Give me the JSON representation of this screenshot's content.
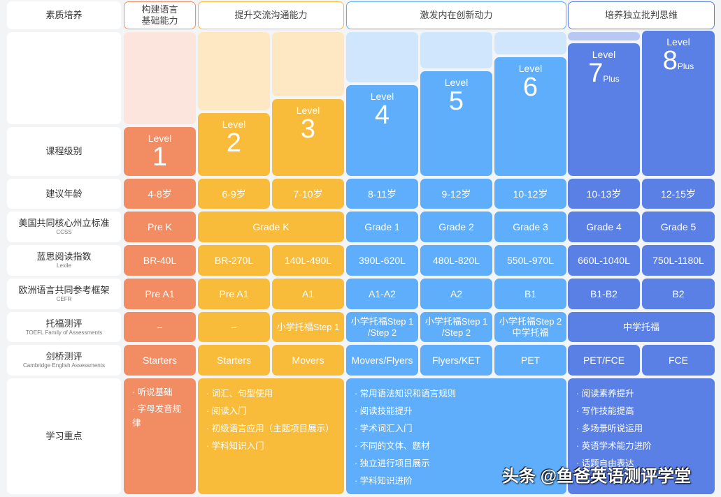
{
  "colors": {
    "orange": "#f28c63",
    "orange_light": "#fbe5dc",
    "yellow": "#f8bb3a",
    "yellow_light": "#fde8c3",
    "blue": "#5eaefc",
    "blue_light": "#cfe6fd",
    "indigo": "#5a80e6",
    "indigo_light": "#b9c8f3"
  },
  "header": {
    "label": "素质培养",
    "groups": [
      {
        "text": "构建语言基础能力",
        "span": [
          1,
          1
        ],
        "color": "orange"
      },
      {
        "text": "提升交流沟通能力",
        "span": [
          2,
          3
        ],
        "color": "yellow"
      },
      {
        "text": "激发内在创新动力",
        "span": [
          4,
          6
        ],
        "color": "blue"
      },
      {
        "text": "培养独立批判思维",
        "span": [
          7,
          8
        ],
        "color": "indigo"
      }
    ]
  },
  "level_label": "课程级别",
  "levels": [
    {
      "word": "Level",
      "num": "1",
      "suffix": ""
    },
    {
      "word": "Level",
      "num": "2",
      "suffix": ""
    },
    {
      "word": "Level",
      "num": "3",
      "suffix": ""
    },
    {
      "word": "Level",
      "num": "4",
      "suffix": ""
    },
    {
      "word": "Level",
      "num": "5",
      "suffix": ""
    },
    {
      "word": "Level",
      "num": "6",
      "suffix": ""
    },
    {
      "word": "Level",
      "num": "7",
      "suffix": "Plus"
    },
    {
      "word": "Level",
      "num": "8",
      "suffix": "Plus"
    }
  ],
  "rows": [
    {
      "label": "建议年龄",
      "sub": "",
      "cells": [
        {
          "t": "4-8岁",
          "s": [
            1,
            1
          ]
        },
        {
          "t": "6-9岁",
          "s": [
            2,
            2
          ]
        },
        {
          "t": "7-10岁",
          "s": [
            3,
            3
          ]
        },
        {
          "t": "8-11岁",
          "s": [
            4,
            4
          ]
        },
        {
          "t": "9-12岁",
          "s": [
            5,
            5
          ]
        },
        {
          "t": "10-12岁",
          "s": [
            6,
            6
          ]
        },
        {
          "t": "10-13岁",
          "s": [
            7,
            7
          ]
        },
        {
          "t": "12-15岁",
          "s": [
            8,
            8
          ]
        }
      ]
    },
    {
      "label": "美国共同核心州立标准",
      "sub": "CCSS",
      "cells": [
        {
          "t": "Pre K",
          "s": [
            1,
            1
          ]
        },
        {
          "t": "Grade K",
          "s": [
            2,
            3
          ]
        },
        {
          "t": "Grade 1",
          "s": [
            4,
            4
          ]
        },
        {
          "t": "Grade 2",
          "s": [
            5,
            5
          ]
        },
        {
          "t": "Grade 3",
          "s": [
            6,
            6
          ]
        },
        {
          "t": "Grade 4",
          "s": [
            7,
            7
          ]
        },
        {
          "t": "Grade 5",
          "s": [
            8,
            8
          ]
        }
      ]
    },
    {
      "label": "蓝思阅读指数",
      "sub": "Lexile",
      "cells": [
        {
          "t": "BR-40L",
          "s": [
            1,
            1
          ]
        },
        {
          "t": "BR-270L",
          "s": [
            2,
            2
          ]
        },
        {
          "t": "140L-490L",
          "s": [
            3,
            3
          ]
        },
        {
          "t": "390L-620L",
          "s": [
            4,
            4
          ]
        },
        {
          "t": "480L-820L",
          "s": [
            5,
            5
          ]
        },
        {
          "t": "550L-970L",
          "s": [
            6,
            6
          ]
        },
        {
          "t": "660L-1040L",
          "s": [
            7,
            7
          ]
        },
        {
          "t": "750L-1180L",
          "s": [
            8,
            8
          ]
        }
      ]
    },
    {
      "label": "欧洲语言共同参考框架",
      "sub": "CEFR",
      "cells": [
        {
          "t": "Pre A1",
          "s": [
            1,
            1
          ]
        },
        {
          "t": "Pre A1",
          "s": [
            2,
            2
          ]
        },
        {
          "t": "A1",
          "s": [
            3,
            3
          ]
        },
        {
          "t": "A1-A2",
          "s": [
            4,
            4
          ]
        },
        {
          "t": "A2",
          "s": [
            5,
            5
          ]
        },
        {
          "t": "B1",
          "s": [
            6,
            6
          ]
        },
        {
          "t": "B1-B2",
          "s": [
            7,
            7
          ]
        },
        {
          "t": "B2",
          "s": [
            8,
            8
          ]
        }
      ]
    },
    {
      "label": "托福测评",
      "sub": "TOEFL Family of Assessments",
      "cells": [
        {
          "t": "–",
          "s": [
            1,
            1
          ]
        },
        {
          "t": "–",
          "s": [
            2,
            2
          ]
        },
        {
          "t": "小学托福Step 1",
          "s": [
            3,
            3
          ]
        },
        {
          "t": "小学托福Step 1 /Step 2",
          "s": [
            4,
            4
          ]
        },
        {
          "t": "小学托福Step 1 /Step 2",
          "s": [
            5,
            5
          ]
        },
        {
          "t": "小学托福Step 2 中学托福",
          "s": [
            6,
            6
          ]
        },
        {
          "t": "中学托福",
          "s": [
            7,
            8
          ]
        }
      ]
    },
    {
      "label": "剑桥测评",
      "sub": "Cambridge English Assessments",
      "cells": [
        {
          "t": "Starters",
          "s": [
            1,
            1
          ]
        },
        {
          "t": "Starters",
          "s": [
            2,
            2
          ]
        },
        {
          "t": "Movers",
          "s": [
            3,
            3
          ]
        },
        {
          "t": "Movers/Flyers",
          "s": [
            4,
            4
          ]
        },
        {
          "t": "Flyers/KET",
          "s": [
            5,
            5
          ]
        },
        {
          "t": "PET",
          "s": [
            6,
            6
          ]
        },
        {
          "t": "PET/FCE",
          "s": [
            7,
            7
          ]
        },
        {
          "t": "FCE",
          "s": [
            8,
            8
          ]
        }
      ]
    }
  ],
  "focus": {
    "label": "学习重点",
    "groups": [
      {
        "s": [
          1,
          1
        ],
        "items": [
          "听说基础",
          "字母发音规律"
        ]
      },
      {
        "s": [
          2,
          3
        ],
        "items": [
          "词汇、句型使用",
          "阅读入门",
          "初级语言应用（主题项目展示）",
          "学科知识入门"
        ]
      },
      {
        "s": [
          4,
          6
        ],
        "items": [
          "常用语法知识和语言规则",
          "阅读技能提升",
          "学术词汇入门",
          "不同的文体、题材",
          "独立进行项目展示",
          "学科知识进阶"
        ]
      },
      {
        "s": [
          7,
          8
        ],
        "items": [
          "阅读素养提升",
          "写作技能提高",
          "多场景听说运用",
          "英语学术能力进阶",
          "话题自由表达"
        ]
      }
    ]
  },
  "watermark": "头条 @鱼爸英语测评学堂"
}
